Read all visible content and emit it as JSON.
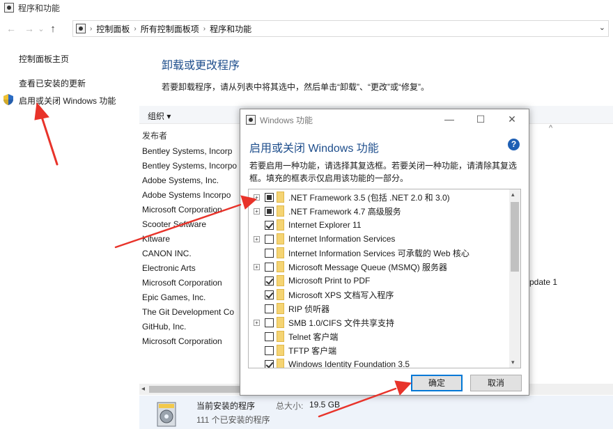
{
  "window": {
    "title": "程序和功能"
  },
  "address": {
    "back": "←",
    "forward": "→",
    "recent": "⌄",
    "up": "↑",
    "crumbs": [
      "控制面板",
      "所有控制面板项",
      "程序和功能"
    ],
    "separator": "›",
    "dropdown": "⌄"
  },
  "leftnav": {
    "home": "控制面板主页",
    "installed_updates": "查看已安装的更新",
    "windows_features": "启用或关闭 Windows 功能"
  },
  "main": {
    "title": "卸载或更改程序",
    "description": "若要卸载程序，请从列表中将其选中，然后单击“卸载”、“更改”或“修复”。",
    "toolbar_organize": "组织 ▾",
    "column_publisher": "发布者",
    "sort_caret": "^",
    "publishers": [
      "Bentley Systems, Incorp",
      "Bentley Systems, Incorpo",
      "Adobe Systems, Inc.",
      "Adobe Systems Incorpo",
      "Microsoft Corporation",
      "Scooter Software",
      "Kitware",
      "CANON INC.",
      "Electronic Arts",
      "Microsoft Corporation",
      "Epic Games, Inc.",
      "The Git Development Co",
      "GitHub, Inc.",
      "Microsoft Corporation"
    ],
    "obscured_text_fragment": "pdate 1"
  },
  "scrollbar": {
    "left_arrow": "◂"
  },
  "status": {
    "current_programs": "当前安装的程序",
    "total_size_label": "总大小:",
    "total_size": "19.5 GB",
    "installed_count": "111 个已安装的程序"
  },
  "dialog": {
    "title": "Windows 功能",
    "minimize": "—",
    "maximize": "☐",
    "close": "✕",
    "heading": "启用或关闭 Windows 功能",
    "help": "?",
    "description": "若要启用一种功能，请选择其复选框。若要关闭一种功能，请清除其复选框。填充的框表示仅启用该功能的一部分。",
    "features": [
      {
        "label": ".NET Framework 3.5 (包括 .NET 2.0 和 3.0)",
        "expandable": true,
        "state": "partial"
      },
      {
        "label": ".NET Framework 4.7 高级服务",
        "expandable": true,
        "state": "partial"
      },
      {
        "label": "Internet Explorer 11",
        "expandable": false,
        "state": "checked"
      },
      {
        "label": "Internet Information Services",
        "expandable": true,
        "state": "unchecked"
      },
      {
        "label": "Internet Information Services 可承载的 Web 核心",
        "expandable": false,
        "state": "unchecked"
      },
      {
        "label": "Microsoft Message Queue (MSMQ) 服务器",
        "expandable": true,
        "state": "unchecked"
      },
      {
        "label": "Microsoft Print to PDF",
        "expandable": false,
        "state": "checked"
      },
      {
        "label": "Microsoft XPS 文档写入程序",
        "expandable": false,
        "state": "checked"
      },
      {
        "label": "RIP 侦听器",
        "expandable": false,
        "state": "unchecked"
      },
      {
        "label": "SMB 1.0/CIFS 文件共享支持",
        "expandable": true,
        "state": "unchecked"
      },
      {
        "label": "Telnet 客户端",
        "expandable": false,
        "state": "unchecked"
      },
      {
        "label": "TFTP 客户端",
        "expandable": false,
        "state": "unchecked"
      },
      {
        "label": "Windows Identity Foundation 3.5",
        "expandable": false,
        "state": "checked"
      }
    ],
    "scroll_up": "▴",
    "scroll_down": "▾",
    "ok_label": "确定",
    "cancel_label": "取消"
  },
  "colors": {
    "heading_blue": "#1e4e8c",
    "annotation_red": "#e8332a",
    "primary_button_border": "#0078d7",
    "folder_yellow": "#f5d473"
  }
}
